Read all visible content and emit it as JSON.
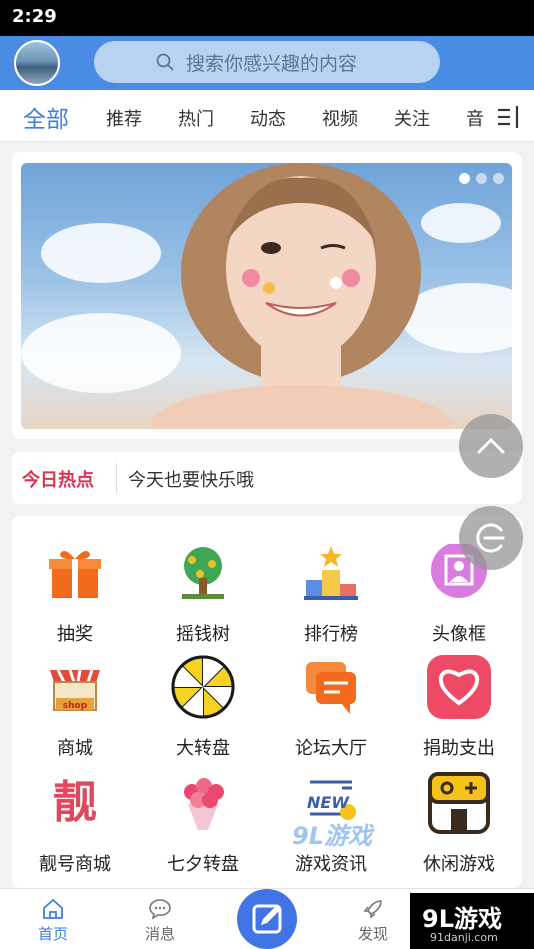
{
  "status_bar": {
    "time": "2:29"
  },
  "search": {
    "placeholder": "搜索你感兴趣的内容"
  },
  "tabs": [
    {
      "label": "全部",
      "active": true
    },
    {
      "label": "推荐"
    },
    {
      "label": "热门"
    },
    {
      "label": "动态"
    },
    {
      "label": "视频"
    },
    {
      "label": "关注"
    },
    {
      "label": "音"
    }
  ],
  "banner": {
    "pages": 3,
    "current": 1
  },
  "hot": {
    "title": "今日热点",
    "text": "今天也要快乐哦"
  },
  "grid": [
    {
      "label": "抽奖",
      "icon": "gift-icon"
    },
    {
      "label": "摇钱树",
      "icon": "money-tree-icon"
    },
    {
      "label": "排行榜",
      "icon": "podium-icon"
    },
    {
      "label": "头像框",
      "icon": "avatar-frame-icon"
    },
    {
      "label": "商城",
      "icon": "shop-icon"
    },
    {
      "label": "大转盘",
      "icon": "wheel-icon"
    },
    {
      "label": "论坛大厅",
      "icon": "chat-icon"
    },
    {
      "label": "捐助支出",
      "icon": "heart-icon"
    },
    {
      "label": "靓号商城",
      "icon": "liang-icon",
      "glyph": "靓"
    },
    {
      "label": "七夕转盘",
      "icon": "bouquet-icon"
    },
    {
      "label": "游戏资讯",
      "icon": "news-icon",
      "badge": "NEW"
    },
    {
      "label": "休闲游戏",
      "icon": "gamepad-icon"
    }
  ],
  "bottom_nav": [
    {
      "label": "首页",
      "active": true
    },
    {
      "label": "消息"
    },
    {
      "label": "发现"
    }
  ],
  "watermark": {
    "main": "9L游戏",
    "sub": "91danji.com",
    "overlay": "9L游戏"
  },
  "colors": {
    "primary": "#4a8be4",
    "accent": "#3d7fdc",
    "hot": "#d8344f"
  }
}
